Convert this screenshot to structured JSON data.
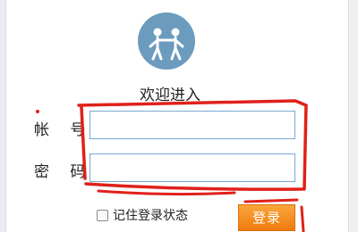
{
  "welcome_text": "欢迎进入",
  "form": {
    "username_label": "帐 号",
    "username_value": "",
    "password_label": "密 码",
    "password_value": "",
    "remember_label": "记住登录状态",
    "remember_checked": false,
    "login_button": "登录"
  },
  "icons": {
    "logo": "people-logo-icon",
    "checkbox": "checkbox-unchecked-icon"
  },
  "colors": {
    "logo_bg": "#6b9bbd",
    "button_bg": "#f08a1c",
    "field_border": "#7aa7d2",
    "annotation": "#e0201a"
  }
}
